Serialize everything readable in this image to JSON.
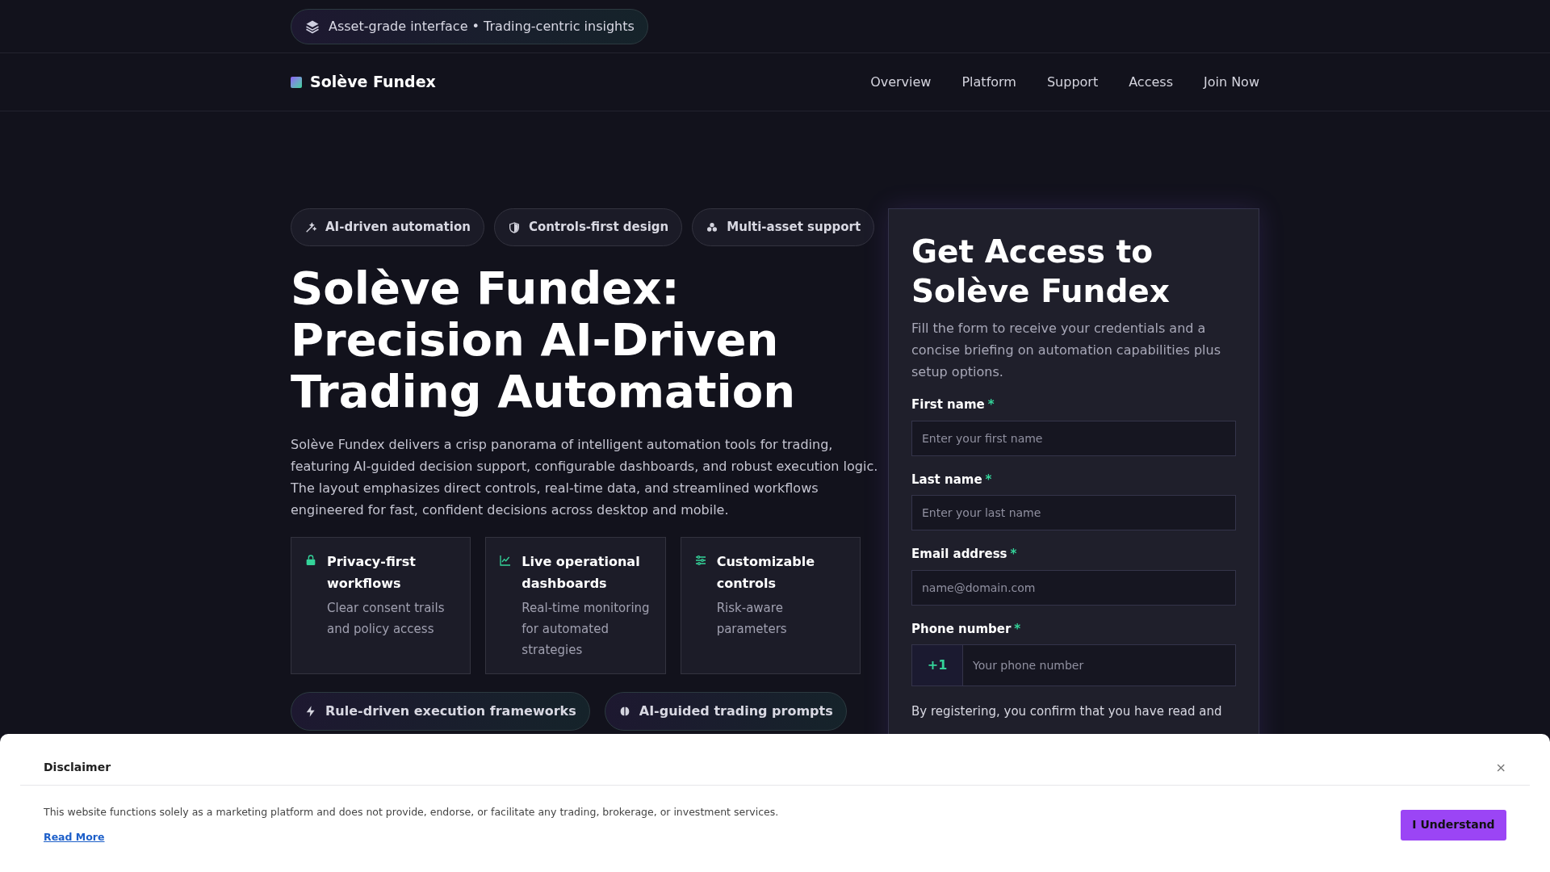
{
  "announcement": {
    "text": "Asset-grade interface • Trading-centric insights"
  },
  "nav": {
    "brand": "Solève Fundex",
    "links": [
      {
        "label": "Overview"
      },
      {
        "label": "Platform"
      },
      {
        "label": "Support"
      },
      {
        "label": "Access"
      },
      {
        "label": "Join Now"
      }
    ]
  },
  "hero": {
    "tags": [
      {
        "kind": "wand",
        "label": "AI-driven automation"
      },
      {
        "kind": "shield",
        "label": "Controls-first design"
      },
      {
        "kind": "cubes",
        "label": "Multi-asset support"
      }
    ],
    "title": "Solève Fundex: Precision AI-Driven Trading Automation",
    "description": "Solève Fundex delivers a crisp panorama of intelligent automation tools for trading, featuring AI-guided decision support, configurable dashboards, and robust execution logic. The layout emphasizes direct controls, real-time data, and streamlined workflows engineered for fast, confident decisions across desktop and mobile.",
    "features": [
      {
        "kind": "lock",
        "title": "Privacy-first workflows",
        "text": "Clear consent trails and policy access"
      },
      {
        "kind": "chart",
        "title": "Live operational dashboards",
        "text": "Real-time monitoring for automated strategies"
      },
      {
        "kind": "sliders",
        "title": "Customizable controls",
        "text": "Risk-aware parameters"
      }
    ],
    "highlights": [
      {
        "kind": "bolt",
        "label": "Rule-driven execution frameworks"
      },
      {
        "kind": "brain",
        "label": "AI-guided trading prompts"
      }
    ]
  },
  "form": {
    "title": "Get Access to Solève Fundex",
    "subtitle": "Fill the form to receive your credentials and a concise briefing on automation capabilities plus setup options.",
    "fields": [
      {
        "kind": "text",
        "label": "First name",
        "required_mark": "*",
        "placeholder": "Enter your first name"
      },
      {
        "kind": "text",
        "label": "Last name",
        "required_mark": "*",
        "placeholder": "Enter your last name"
      },
      {
        "kind": "text",
        "label": "Email address",
        "required_mark": "*",
        "placeholder": "name@domain.com"
      },
      {
        "kind": "phone",
        "label": "Phone number",
        "required_mark": "*",
        "prefix": "+1",
        "placeholder": "Your phone number"
      }
    ],
    "consent": {
      "text": "By registering, you confirm that you have read and"
    }
  },
  "disclaimer": {
    "title": "Disclaimer",
    "close": "×",
    "text": "This website functions solely as a marketing platform and does not provide, endorse, or facilitate any trading, brokerage, or investment services.",
    "link": "Read More",
    "button": "I Understand"
  }
}
